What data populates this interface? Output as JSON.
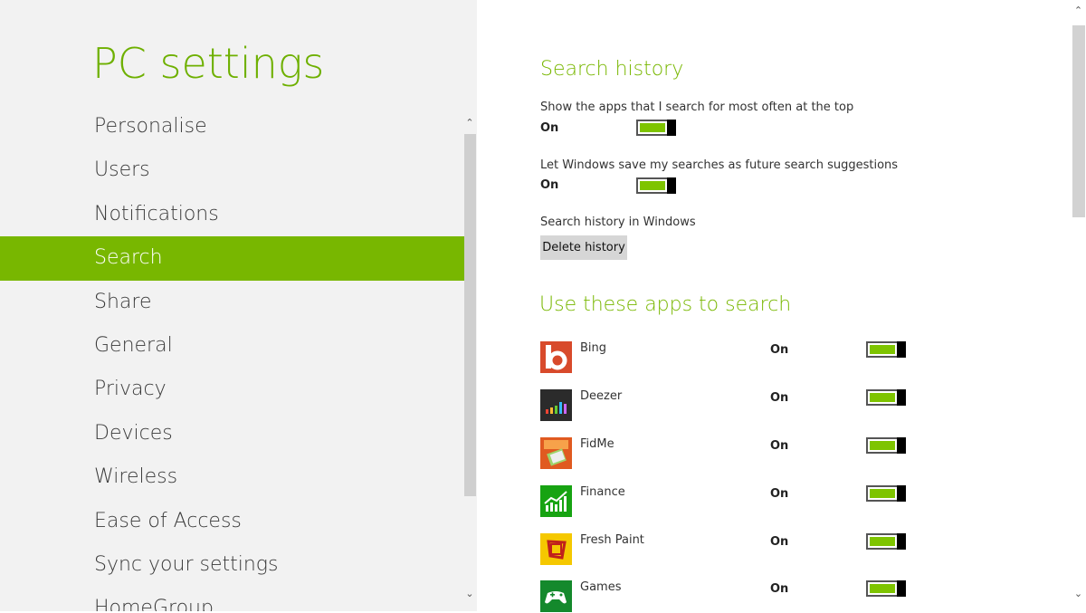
{
  "app_title": "PC settings",
  "nav": [
    {
      "label": "Personalise"
    },
    {
      "label": "Users"
    },
    {
      "label": "Notifications"
    },
    {
      "label": "Search",
      "active": true
    },
    {
      "label": "Share"
    },
    {
      "label": "General"
    },
    {
      "label": "Privacy"
    },
    {
      "label": "Devices"
    },
    {
      "label": "Wireless"
    },
    {
      "label": "Ease of Access"
    },
    {
      "label": "Sync your settings"
    },
    {
      "label": "HomeGroup"
    }
  ],
  "search_history": {
    "title": "Search history",
    "show_apps_label": "Show the apps that I search for most often at the top",
    "show_apps_state": "On",
    "save_searches_label": "Let Windows save my searches as future search suggestions",
    "save_searches_state": "On",
    "history_label": "Search history in Windows",
    "delete_button": "Delete history"
  },
  "apps_section": {
    "title": "Use these apps to search",
    "apps": [
      {
        "name": "Bing",
        "state": "On",
        "icon": "bing-icon",
        "color": "#d84a2b"
      },
      {
        "name": "Deezer",
        "state": "On",
        "icon": "deezer-icon",
        "color": "#2b2b2b"
      },
      {
        "name": "FidMe",
        "state": "On",
        "icon": "fidme-icon",
        "color": "#e05a20"
      },
      {
        "name": "Finance",
        "state": "On",
        "icon": "finance-icon",
        "color": "#17a312"
      },
      {
        "name": "Fresh Paint",
        "state": "On",
        "icon": "fresh-paint-icon",
        "color": "#f5c800"
      },
      {
        "name": "Games",
        "state": "On",
        "icon": "games-icon",
        "color": "#14892c"
      }
    ]
  },
  "colors": {
    "accent": "#78b700",
    "toggle_on": "#7ec400"
  }
}
